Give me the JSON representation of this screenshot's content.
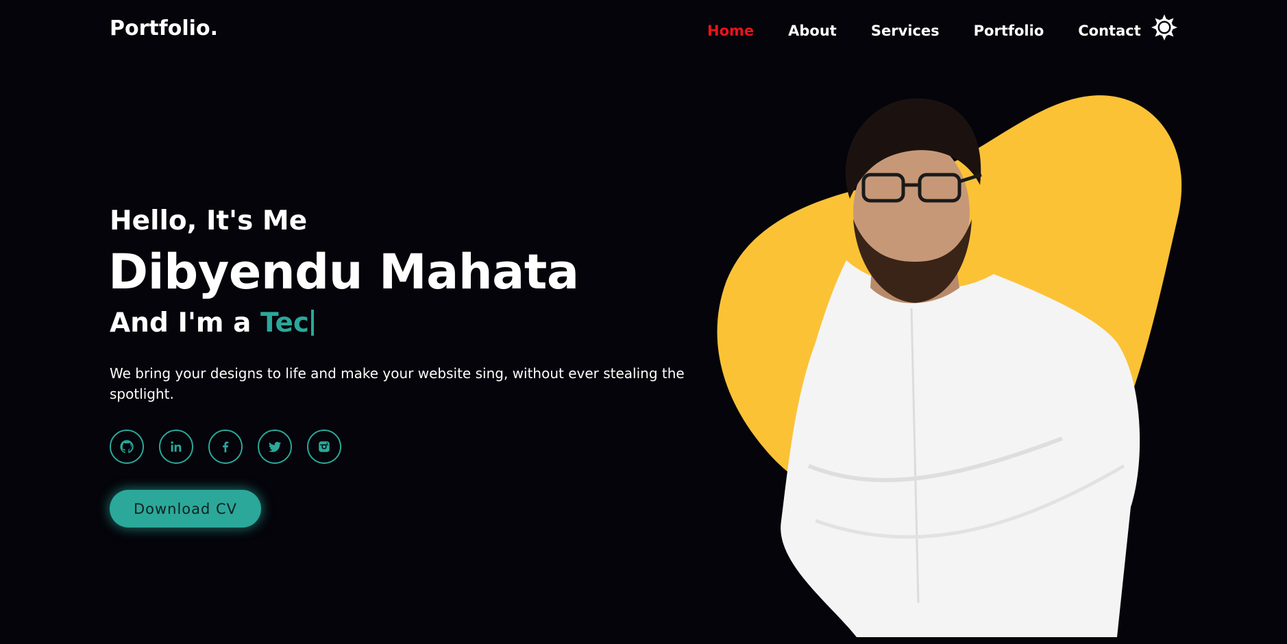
{
  "header": {
    "logo": "Portfolio.",
    "nav": [
      {
        "label": "Home",
        "active": true
      },
      {
        "label": "About",
        "active": false
      },
      {
        "label": "Services",
        "active": false
      },
      {
        "label": "Portfolio",
        "active": false
      },
      {
        "label": "Contact",
        "active": false
      }
    ],
    "theme_icon": "sun-icon"
  },
  "hero": {
    "greeting": "Hello, It's Me",
    "name": "Dibyendu Mahata",
    "role_prefix": "And I'm a ",
    "role_typed": "Tec",
    "description": "We bring your designs to life and make your website sing, without ever stealing the spotlight.",
    "socials": [
      {
        "icon": "github-icon"
      },
      {
        "icon": "linkedin-icon"
      },
      {
        "icon": "facebook-icon"
      },
      {
        "icon": "twitter-icon"
      },
      {
        "icon": "instagram-icon"
      }
    ],
    "cta_label": "Download CV"
  },
  "colors": {
    "background": "#04040a",
    "accent": "#2ba89a",
    "active_nav": "#e8141b",
    "blob": "#fbc236"
  }
}
